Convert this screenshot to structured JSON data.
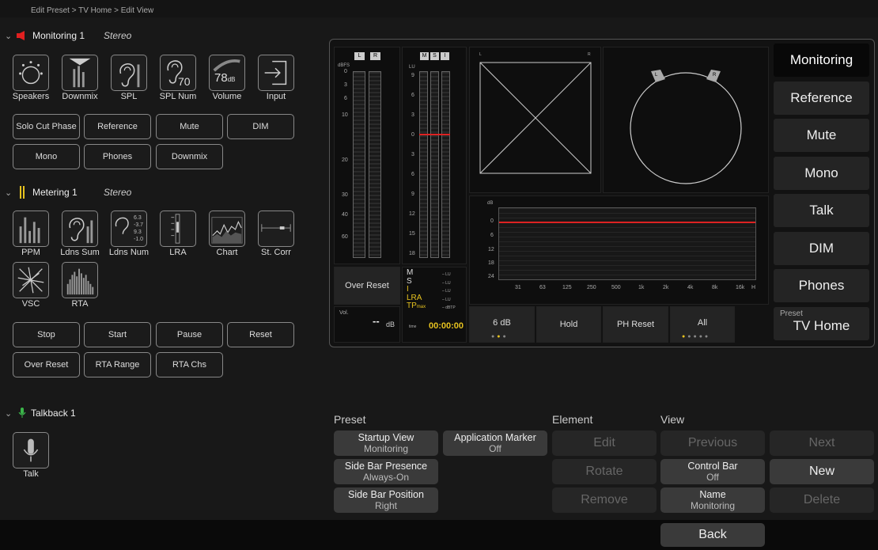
{
  "breadcrumb": "Edit Preset  >  TV Home  >  Edit View",
  "monitoring": {
    "title": "Monitoring 1",
    "mode": "Stereo",
    "icons": [
      "Speakers",
      "Downmix",
      "SPL",
      "SPL Num",
      "Volume",
      "Input"
    ],
    "spl_num": "70",
    "volume_value": "78",
    "volume_unit": "dB",
    "buttons": [
      "Solo Cut Phase",
      "Reference",
      "Mute",
      "DIM",
      "Mono",
      "Phones",
      "Downmix"
    ]
  },
  "metering": {
    "title": "Metering 1",
    "mode": "Stereo",
    "icons": [
      "PPM",
      "Ldns Sum",
      "Ldns Num",
      "LRA",
      "Chart",
      "St. Corr",
      "VSC",
      "RTA"
    ],
    "ldns_vals": [
      "6.3",
      "-3.7",
      "9.3",
      "-1.0"
    ],
    "buttons": [
      "Stop",
      "Start",
      "Pause",
      "Reset",
      "Over Reset",
      "RTA Range",
      "RTA Chs"
    ]
  },
  "talkback": {
    "title": "Talkback 1",
    "icons": [
      "Talk"
    ]
  },
  "preview": {
    "ppm": {
      "L": "L",
      "R": "R",
      "unit": "dBFS",
      "ticks": [
        "0",
        "3",
        "6",
        "10",
        "20",
        "30",
        "40",
        "60"
      ]
    },
    "ldns": {
      "M": "M",
      "S": "S",
      "I": "I",
      "unit": "LU",
      "ticks": [
        "9",
        "6",
        "3",
        "0",
        "3",
        "6",
        "9",
        "12",
        "15",
        "18"
      ]
    },
    "gonio": {
      "L": "L",
      "R": "R"
    },
    "vsc": {
      "L": "L",
      "R": "R"
    },
    "rta": {
      "unit": "dB",
      "yticks": [
        "0",
        "6",
        "12",
        "18",
        "24"
      ],
      "xticks": [
        "31",
        "63",
        "125",
        "250",
        "500",
        "1k",
        "2k",
        "4k",
        "8k",
        "16k",
        "H"
      ]
    },
    "over_reset": "Over Reset",
    "vol": {
      "label": "Vol.",
      "value": "--",
      "unit": "dB"
    },
    "loud_readout": {
      "rows": [
        "M",
        "S",
        "I",
        "LRA",
        "TP"
      ],
      "tp_sub": "max",
      "unit": "LU",
      "tp_unit": "dBTP",
      "time_label": "time",
      "time": "00:00:00"
    },
    "bottom_buttons": [
      "6 dB",
      "Hold",
      "PH Reset",
      "All"
    ],
    "side": [
      "Monitoring",
      "Reference",
      "Mute",
      "Mono",
      "Talk",
      "DIM",
      "Phones"
    ],
    "preset_label": "Preset",
    "preset_name": "TV Home"
  },
  "sections": {
    "preset": "Preset",
    "element": "Element",
    "view": "View"
  },
  "preset_buttons": [
    {
      "title": "Startup View",
      "value": "Monitoring"
    },
    {
      "title": "Application Marker",
      "value": "Off"
    },
    {
      "title": "Side Bar Presence",
      "value": "Always-On"
    },
    {
      "title": "Side Bar Position",
      "value": "Right"
    }
  ],
  "element_buttons": [
    "Edit",
    "Rotate",
    "Remove"
  ],
  "view_buttons": {
    "previous": "Previous",
    "next": "Next",
    "control_bar": {
      "title": "Control Bar",
      "value": "Off"
    },
    "new": "New",
    "name": {
      "title": "Name",
      "value": "Monitoring"
    },
    "delete": "Delete"
  },
  "back": "Back",
  "colors": {
    "meter_red": "#d22",
    "loud_yellow": "#e6c21f",
    "talk_green": "#3bb54a",
    "mon_red": "#e02020",
    "dot_active": "#e6c21f"
  }
}
